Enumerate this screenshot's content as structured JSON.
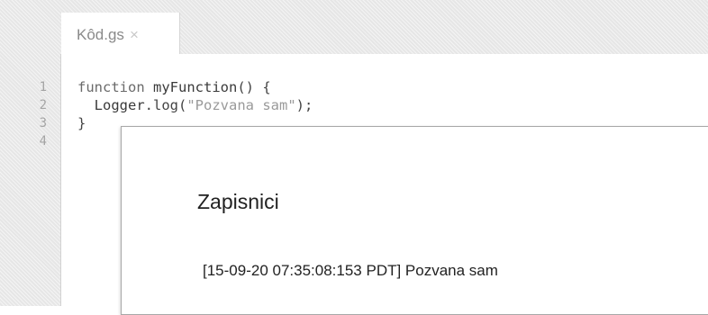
{
  "tab": {
    "label": "Kôd.gs",
    "close_glyph": "×"
  },
  "editor": {
    "line_numbers": [
      "1",
      "2",
      "3",
      "4"
    ],
    "code": {
      "line1_keyword": "function",
      "line1_name": "myFunction",
      "line1_rest": "() {",
      "line2_object": "Logger",
      "line2_method": ".log(",
      "line2_string": "\"Pozvana sam\"",
      "line2_end": ");",
      "line3": "}"
    }
  },
  "logs_dialog": {
    "title": "Zapisnici",
    "entries": [
      "[15-09-20 07:35:08:153 PDT] Pozvana sam"
    ]
  }
}
